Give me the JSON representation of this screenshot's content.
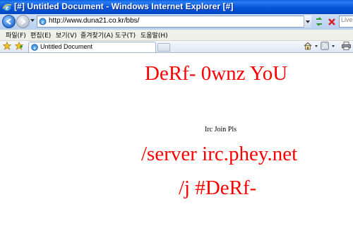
{
  "window": {
    "title": "[#] Untitled Document - Windows Internet Explorer [#]"
  },
  "address_bar": {
    "url": "http://www.duna21.co.kr/bbs/",
    "search_placeholder": "Live Search"
  },
  "menu": {
    "items": [
      "파일(F)",
      "편집(E)",
      "보기(V)",
      "즐겨찾기(A)",
      "도구(T)",
      "도움말(H)"
    ]
  },
  "tabs": [
    {
      "label": "Untitled Document",
      "active": true
    }
  ],
  "page": {
    "headline": "DeRf- 0wnz YoU",
    "note": "Irc Join Pls",
    "server": "/server irc.phey.net",
    "channel": "/j #DeRf-"
  },
  "colors": {
    "text_accent": "#ff0000",
    "titlebar": "#0554d8"
  },
  "icons": {
    "titlebar": "ie-icon",
    "back": "back-arrow-icon",
    "forward": "forward-arrow-icon",
    "refresh": "refresh-icon",
    "stop": "stop-icon",
    "favorites": "favorites-star-icon",
    "add_favorites": "add-favorites-icon",
    "home": "home-icon",
    "feeds": "feeds-icon",
    "print": "printer-icon"
  }
}
